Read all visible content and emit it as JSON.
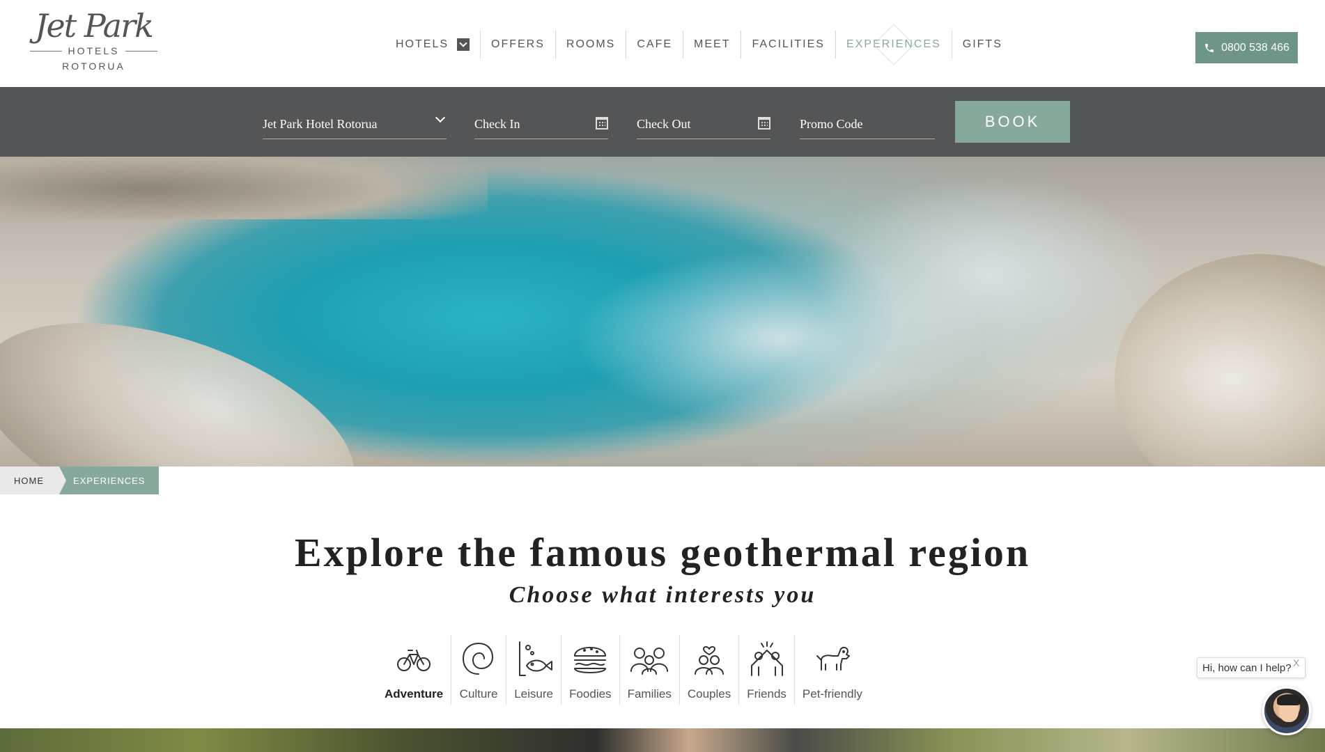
{
  "logo": {
    "script": "Jet Park",
    "hotels": "HOTELS",
    "city": "ROTORUA"
  },
  "nav": {
    "items": [
      {
        "label": "HOTELS"
      },
      {
        "label": "OFFERS"
      },
      {
        "label": "ROOMS"
      },
      {
        "label": "CAFE"
      },
      {
        "label": "MEET"
      },
      {
        "label": "FACILITIES"
      },
      {
        "label": "EXPERIENCES"
      },
      {
        "label": "GIFTS"
      }
    ],
    "active": "EXPERIENCES"
  },
  "phone": {
    "label": "0800 538 466",
    "icon": "phone-icon"
  },
  "booking": {
    "hotel_select": "Jet Park Hotel Rotorua",
    "check_in_placeholder": "Check In",
    "check_out_placeholder": "Check Out",
    "promo_placeholder": "Promo Code",
    "book_label": "BOOK"
  },
  "breadcrumb": {
    "home": "HOME",
    "current": "EXPERIENCES"
  },
  "content": {
    "headline": "Explore the famous geothermal region",
    "subline": "Choose what interests you"
  },
  "interests": [
    {
      "label": "Adventure",
      "icon": "bicycle-icon",
      "active": true
    },
    {
      "label": "Culture",
      "icon": "koru-icon"
    },
    {
      "label": "Leisure",
      "icon": "fishing-icon"
    },
    {
      "label": "Foodies",
      "icon": "burger-icon"
    },
    {
      "label": "Families",
      "icon": "family-icon"
    },
    {
      "label": "Couples",
      "icon": "couple-icon"
    },
    {
      "label": "Friends",
      "icon": "friends-icon"
    },
    {
      "label": "Pet-friendly",
      "icon": "dog-icon"
    }
  ],
  "chat": {
    "greeting": "Hi, how can I help?",
    "close": "X"
  },
  "colors": {
    "accent": "#86a99c",
    "booking_bar": "#545556",
    "phone_button": "#6f9588"
  }
}
